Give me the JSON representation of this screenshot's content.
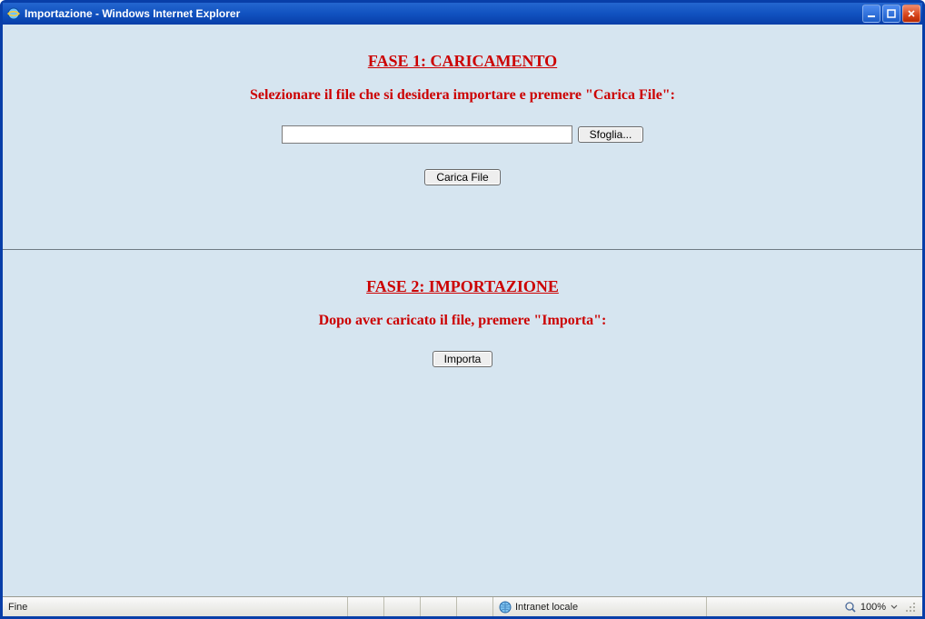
{
  "window": {
    "title": "Importazione - Windows Internet Explorer"
  },
  "phase1": {
    "heading": "FASE 1: CARICAMENTO",
    "instruction": "Selezionare il file che si desidera importare e premere \"Carica File\":",
    "file_value": "",
    "browse_label": "Sfoglia...",
    "load_label": "Carica File"
  },
  "phase2": {
    "heading": "FASE 2: IMPORTAZIONE",
    "instruction": "Dopo aver caricato il file, premere \"Importa\":",
    "import_label": "Importa"
  },
  "statusbar": {
    "status_text": "Fine",
    "zone_label": "Intranet locale",
    "zoom_label": "100%"
  }
}
